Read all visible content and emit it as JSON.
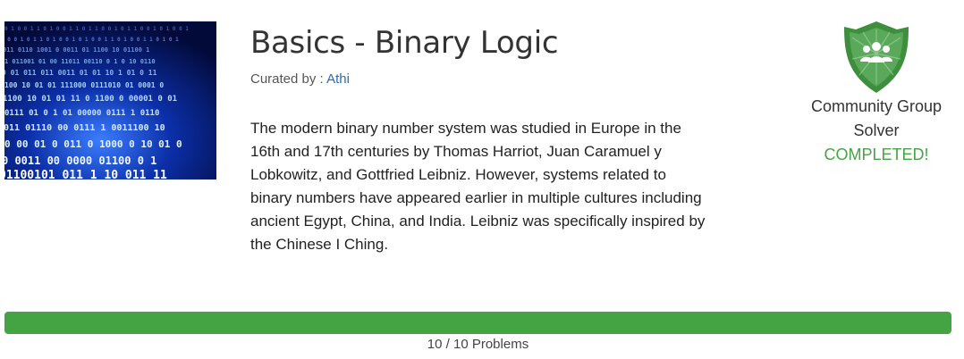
{
  "problem_set": {
    "thumbnail": "binary-code-image",
    "title": "Basics - Binary Logic",
    "curated_prefix": "Curated by : ",
    "curator": "Athi",
    "description_lines": [
      "The modern binary number system was studied in Europe in the",
      "16th and 17th centuries by Thomas Harriot, Juan Caramuel y",
      "Lobkowitz, and Gottfried Leibniz. However, systems related to",
      "binary numbers have appeared earlier in multiple cultures including",
      "ancient Egypt, China, and India. Leibniz was specifically inspired by",
      "the Chinese I Ching."
    ]
  },
  "badge": {
    "icon": "community-group-shield-icon",
    "name_line1": "Community Group",
    "name_line2": "Solver",
    "status": "COMPLETED!",
    "color": "#3d8f3d",
    "status_color": "#45a545"
  },
  "progress": {
    "completed": 10,
    "total": 10,
    "fraction": 1.0,
    "label": "10 / 10 Problems",
    "color": "#44a343"
  }
}
